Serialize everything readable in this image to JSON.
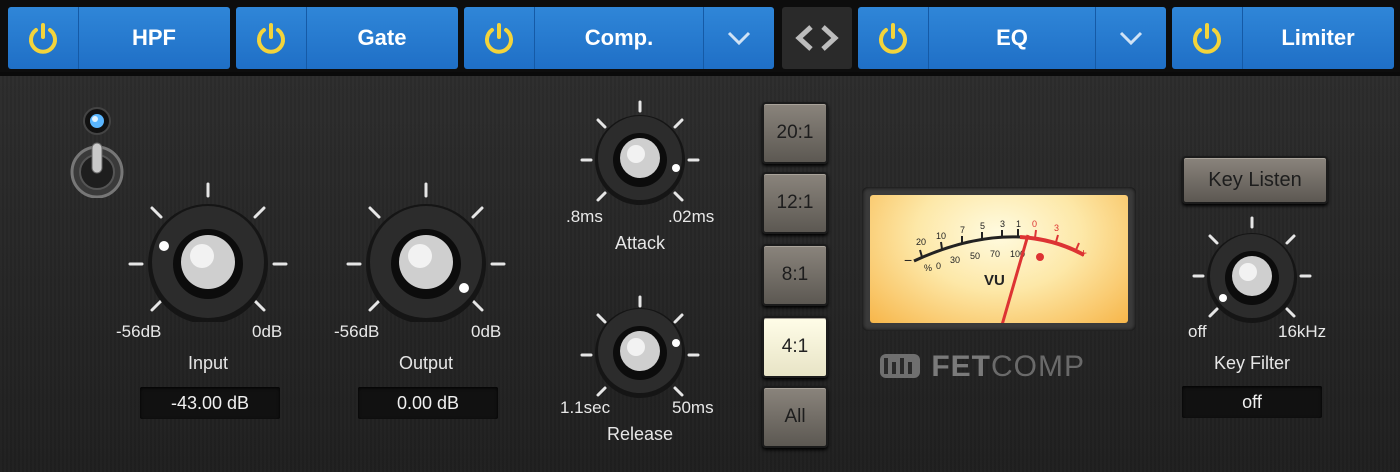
{
  "tabs": [
    {
      "label": "HPF",
      "has_menu": false
    },
    {
      "label": "Gate",
      "has_menu": false
    },
    {
      "label": "Comp.",
      "has_menu": true
    },
    {
      "label": "EQ",
      "has_menu": true
    },
    {
      "label": "Limiter",
      "has_menu": false
    }
  ],
  "input": {
    "label": "Input",
    "min_label": "-56dB",
    "max_label": "0dB",
    "value": "-43.00 dB"
  },
  "output": {
    "label": "Output",
    "min_label": "-56dB",
    "max_label": "0dB",
    "value": "0.00 dB"
  },
  "attack": {
    "label": "Attack",
    "min_label": ".8ms",
    "max_label": ".02ms"
  },
  "release": {
    "label": "Release",
    "min_label": "1.1sec",
    "max_label": "50ms"
  },
  "ratios": [
    {
      "label": "20:1",
      "active": false
    },
    {
      "label": "12:1",
      "active": false
    },
    {
      "label": "8:1",
      "active": false
    },
    {
      "label": "4:1",
      "active": true
    },
    {
      "label": "All",
      "active": false
    }
  ],
  "vu": {
    "scale_top": [
      "20",
      "10",
      "7",
      "5",
      "3",
      "1",
      "0",
      "3"
    ],
    "scale_bottom": [
      "%",
      "0",
      "30",
      "50",
      "70",
      "100"
    ],
    "minus_sign": "−",
    "plus_sign": "+",
    "label": "VU"
  },
  "brand": {
    "fet": "FET",
    "comp": "COMP"
  },
  "key_listen_label": "Key Listen",
  "key_filter": {
    "label": "Key Filter",
    "min_label": "off",
    "max_label": "16kHz",
    "value": "off"
  },
  "colors": {
    "tab_blue": "#2a7fd4",
    "power_yellow": "#f3d43b",
    "active_ratio": "#fbf8dc"
  }
}
